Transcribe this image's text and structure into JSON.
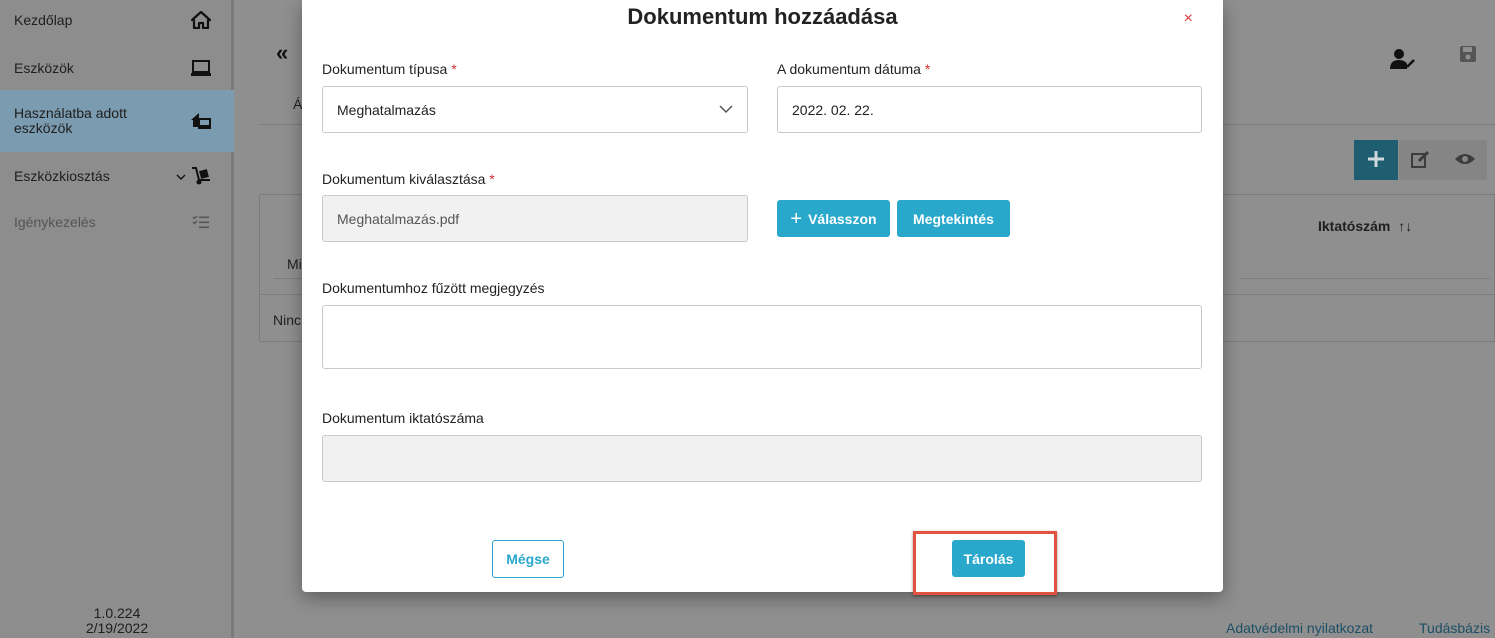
{
  "sidebar": {
    "items": [
      {
        "label": "Kezdőlap",
        "icon": "home-icon"
      },
      {
        "label": "Eszközök",
        "icon": "laptop-icon"
      },
      {
        "label": "Használatba adott eszközök",
        "icon": "house-laptop-icon"
      },
      {
        "label": "Eszközkiosztás",
        "icon": "hand-truck-icon"
      },
      {
        "label": "Igénykezelés",
        "icon": "list-check-icon"
      }
    ],
    "version": "1.0.224",
    "build_date": "2/19/2022"
  },
  "background": {
    "back_glyph": "«",
    "tab_fragment": "Á",
    "filter_fragment": "Mi",
    "empty_fragment": "Ninc",
    "column_header": "Iktatószám",
    "sort_glyph": "↑↓",
    "footer_links": [
      "Adatvédelmi nyilatkozat",
      "Tudásbázis"
    ]
  },
  "modal": {
    "title": "Dokumentum hozzáadása",
    "close_glyph": "×",
    "required_mark": "*",
    "doc_type": {
      "label": "Dokumentum típusa",
      "value": "Meghatalmazás"
    },
    "doc_date": {
      "label": "A dokumentum dátuma",
      "value": "2022. 02. 22."
    },
    "doc_select": {
      "label": "Dokumentum kiválasztása",
      "value": "Meghatalmazás.pdf",
      "choose_button": "Válasszon",
      "preview_button": "Megtekintés"
    },
    "comment": {
      "label": "Dokumentumhoz fűzött megjegyzés",
      "value": ""
    },
    "reg_number": {
      "label": "Dokumentum iktatószáma",
      "value": ""
    },
    "cancel_button": "Mégse",
    "save_button": "Tárolás"
  },
  "colors": {
    "accent": "#29a8cc",
    "required": "#d32f2f",
    "highlight": "#e15241"
  }
}
